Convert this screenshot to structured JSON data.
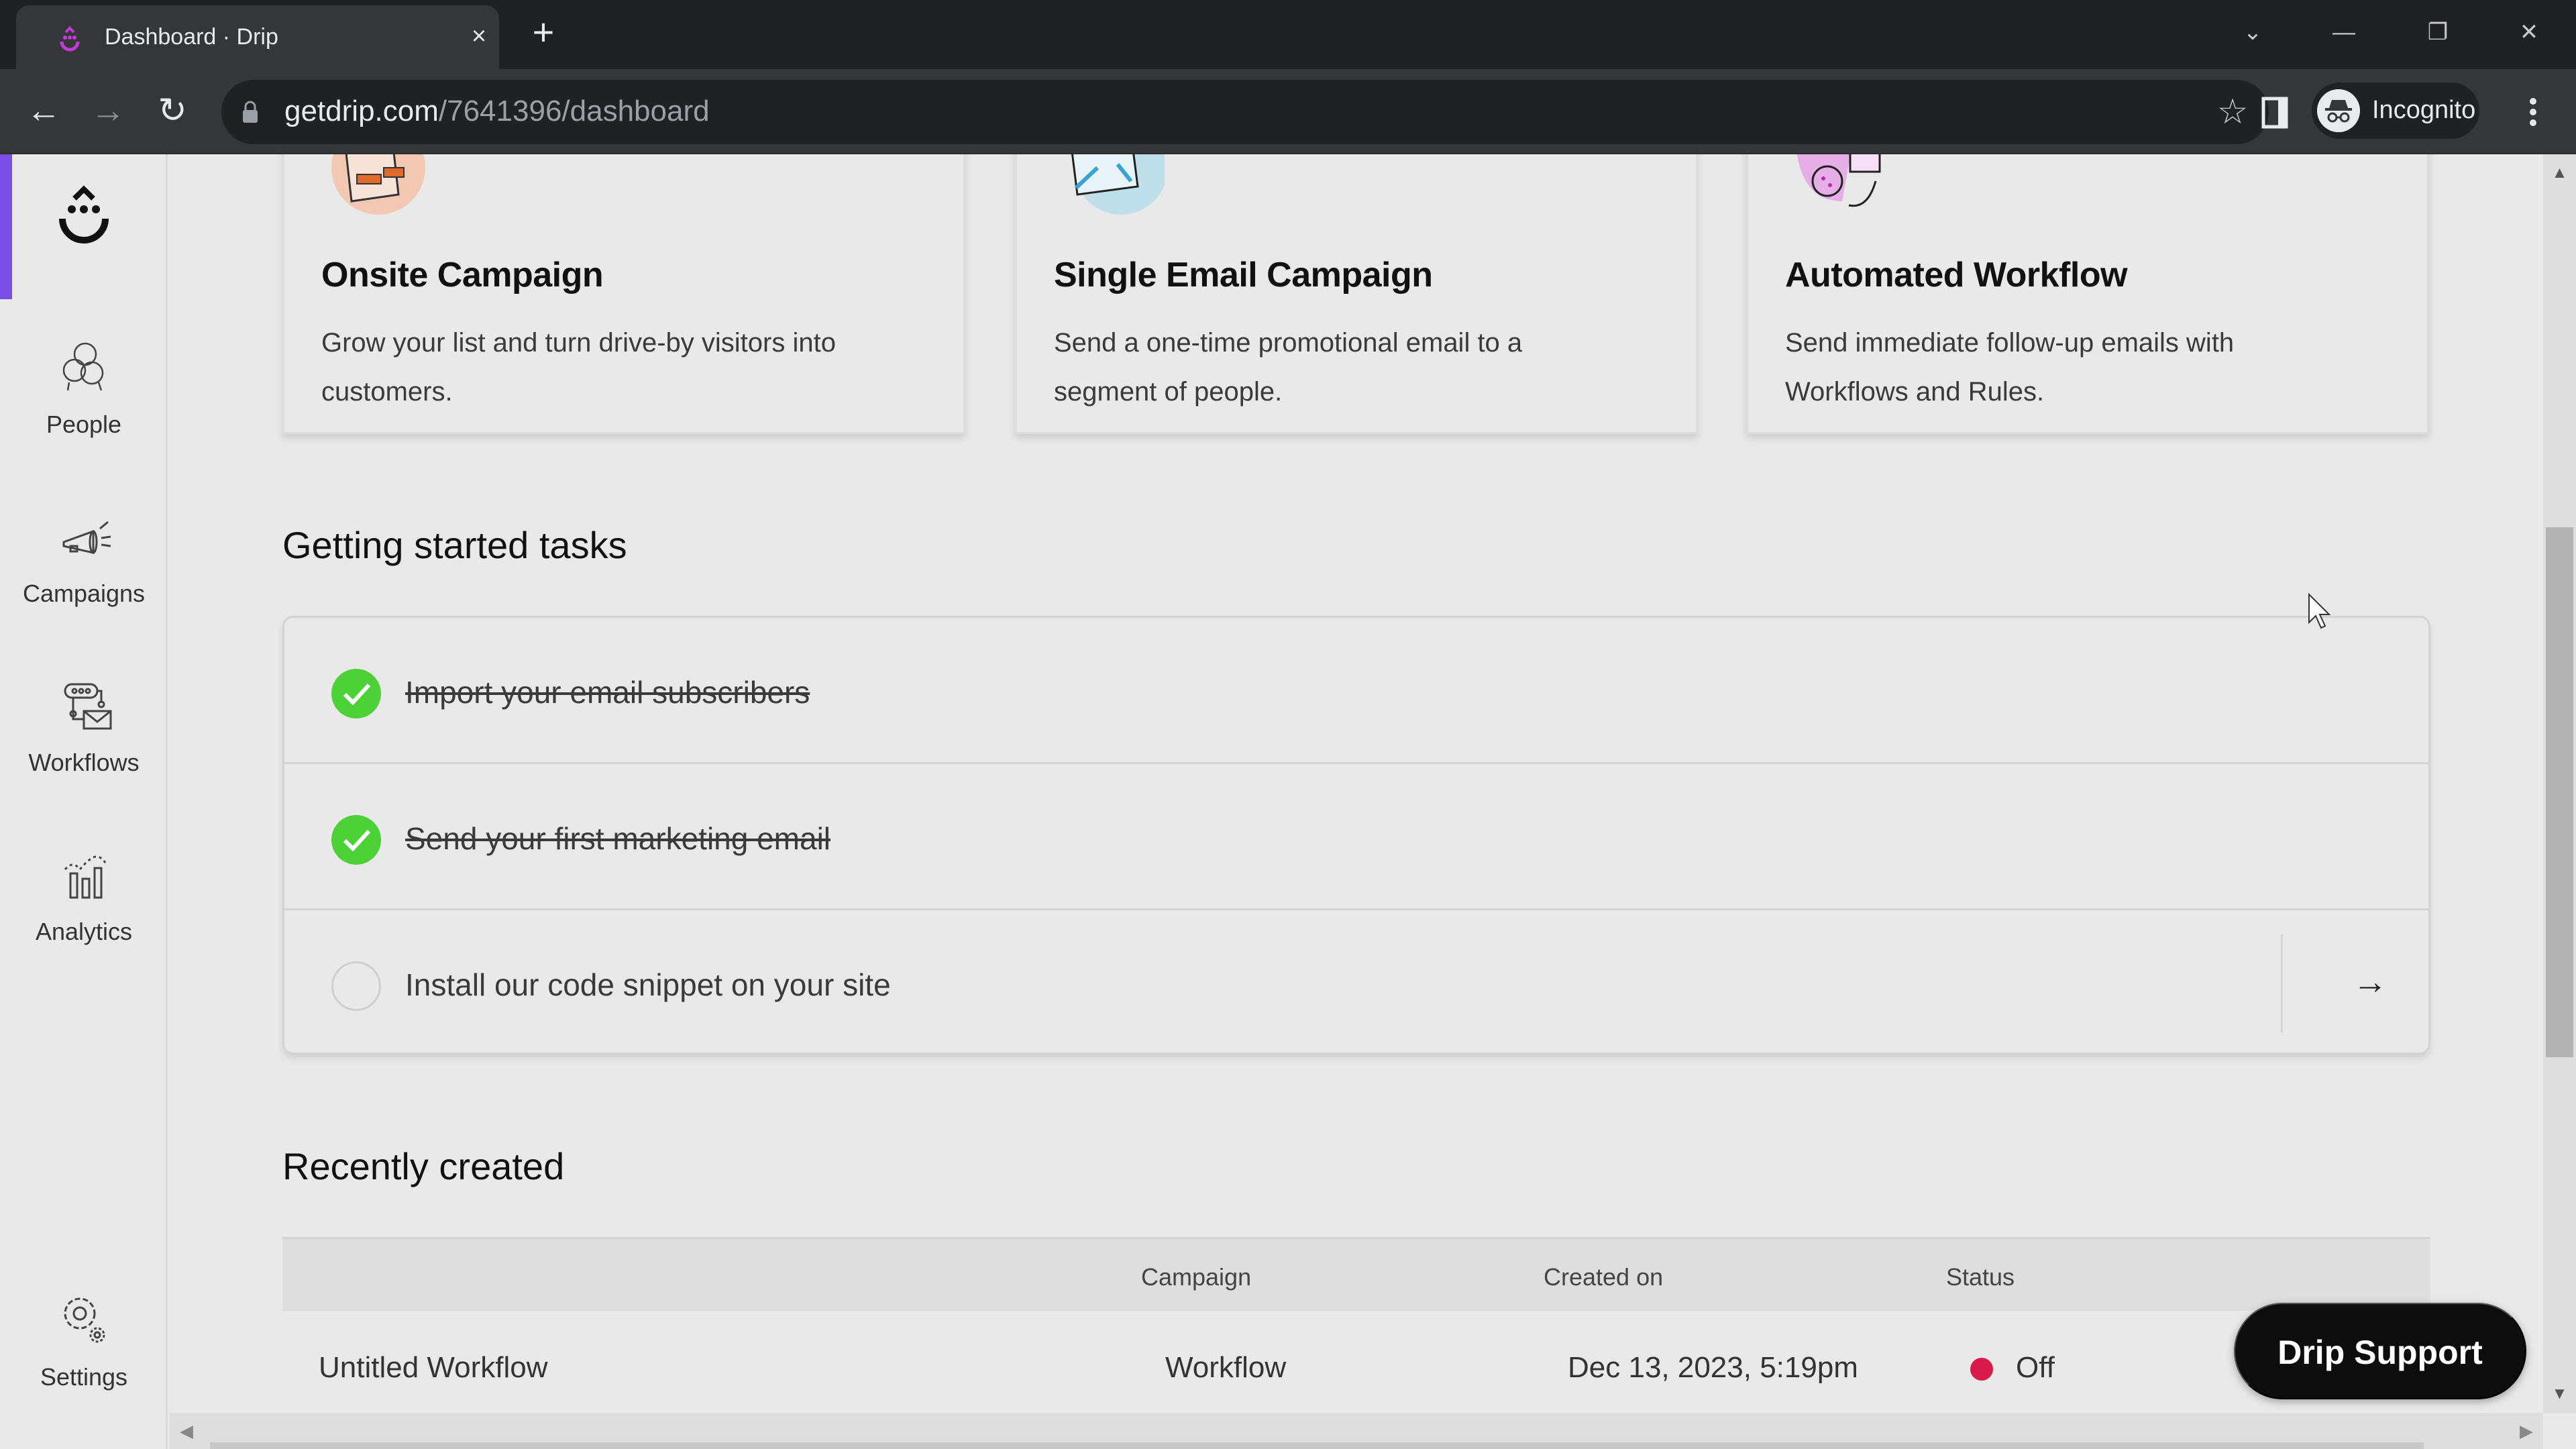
{
  "browser": {
    "tab_title": "Dashboard · Drip",
    "tab_close_icon": "×",
    "new_tab_icon": "+",
    "url_domain": "getdrip.com",
    "url_path": "/7641396/dashboard",
    "profile_label": "Incognito",
    "window_controls": {
      "tab_search": "⌄",
      "minimize": "—",
      "restore": "❐",
      "close": "✕"
    },
    "nav": {
      "back": "←",
      "forward": "→",
      "reload": "↻"
    },
    "bookmark_icon": "☆"
  },
  "sidebar": {
    "accent_color": "#7b4ee8",
    "items": [
      {
        "label": "People",
        "icon": "people-icon"
      },
      {
        "label": "Campaigns",
        "icon": "megaphone-icon"
      },
      {
        "label": "Workflows",
        "icon": "workflow-icon"
      },
      {
        "label": "Analytics",
        "icon": "analytics-icon"
      },
      {
        "label": "Settings",
        "icon": "settings-icon"
      }
    ]
  },
  "cards": [
    {
      "title": "Onsite Campaign",
      "description": "Grow your list and turn drive-by visitors into customers.",
      "accent": "#f2c8b2"
    },
    {
      "title": "Single Email Campaign",
      "description": "Send a one-time promotional email to a segment of people.",
      "accent": "#bfe0ea"
    },
    {
      "title": "Automated Workflow",
      "description": "Send immediate follow-up emails with Workflows and Rules.",
      "accent": "#e6aee6"
    }
  ],
  "tasks": {
    "heading": "Getting started tasks",
    "items": [
      {
        "label": "Import your email subscribers",
        "done": true
      },
      {
        "label": "Send your first marketing email",
        "done": true
      },
      {
        "label": "Install our code snippet on your site",
        "done": false,
        "arrow": "→"
      }
    ],
    "done_color": "#4cd137"
  },
  "recent": {
    "heading": "Recently created",
    "columns": [
      "",
      "Campaign",
      "Created on",
      "Status"
    ],
    "rows": [
      {
        "name": "Untitled Workflow",
        "campaign": "Workflow",
        "created_on": "Dec 13, 2023, 5:19pm",
        "status": "Off",
        "status_color": "#d81b4a"
      }
    ]
  },
  "support_button": "Drip Support",
  "scrollbars": {
    "up": "▲",
    "down": "▼",
    "left": "◀",
    "right": "▶"
  }
}
